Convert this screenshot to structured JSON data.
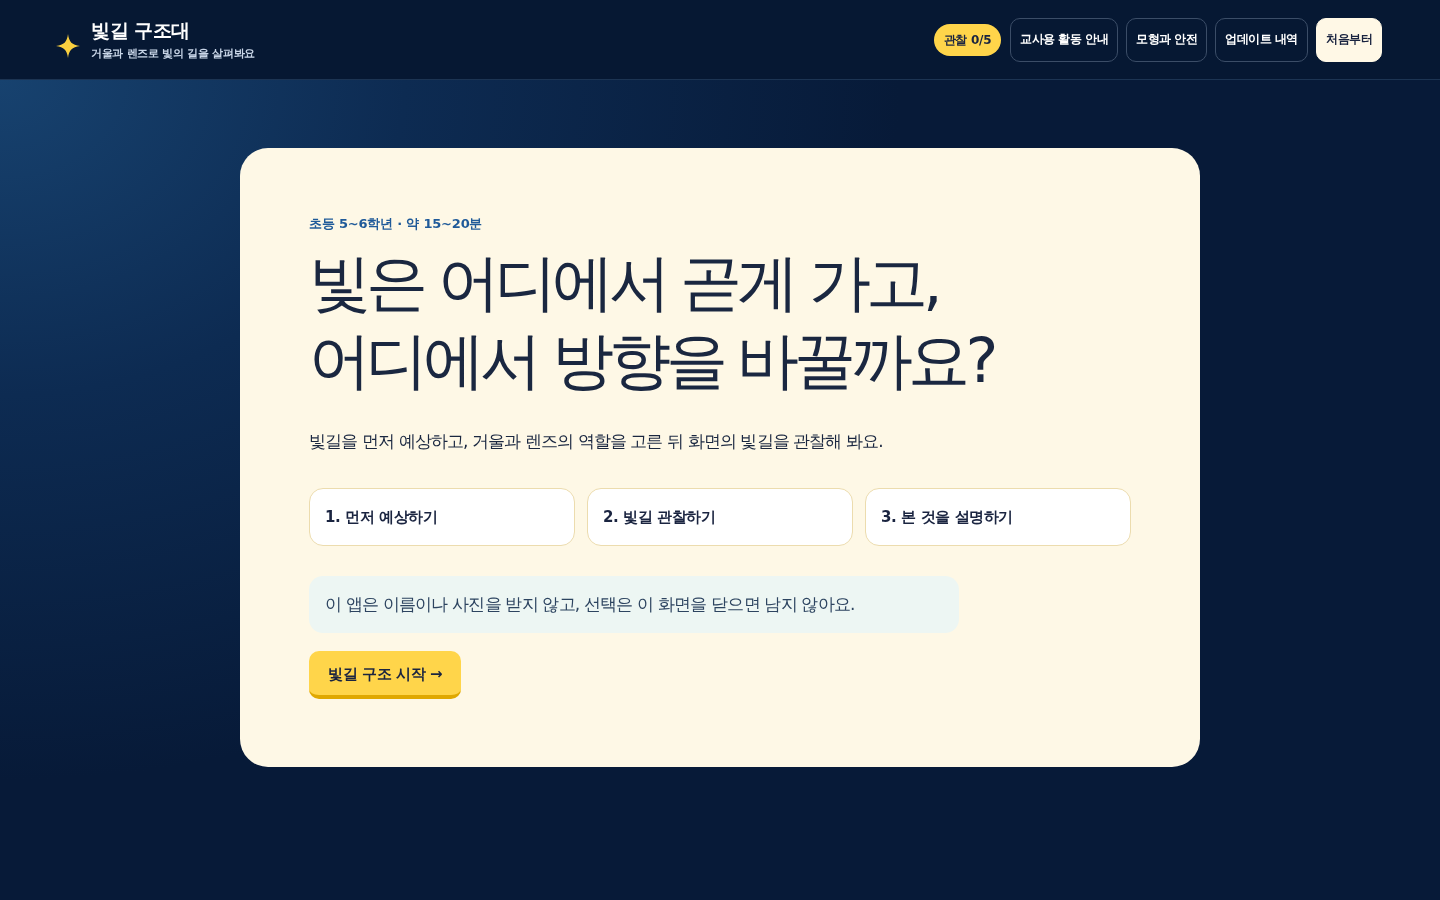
{
  "header": {
    "title": "빛길 구조대",
    "subtitle": "거울과 렌즈로 빛의 길을 살펴봐요"
  },
  "nav": {
    "badge": "관찰 0/5",
    "buttons": [
      {
        "label": "교사용 활동 안내",
        "kind": "outline"
      },
      {
        "label": "모형과 안전",
        "kind": "outline"
      },
      {
        "label": "업데이트 내역",
        "kind": "outline"
      },
      {
        "label": "처음부터",
        "kind": "filled"
      }
    ]
  },
  "intro": {
    "eyebrow": "초등 5~6학년 · 약 15~20분",
    "heading": [
      "빛은 어디에서 곧게 가고,",
      "어디에서 방향을 바꿀까요?"
    ],
    "lead": "빛길을 먼저 예상하고, 거울과 렌즈의 역할을 고른 뒤 화면의 빛길을 관찰해 봐요.",
    "steps": [
      "1. 먼저 예상하기",
      "2. 빛길 관찰하기",
      "3. 본 것을 설명하기"
    ],
    "notice": "이 앱은 이름이나 사진을 받지 않고, 선택은 이 화면을 닫으면 남지 않아요.",
    "start_button": "빛길 구조 시작 →"
  }
}
